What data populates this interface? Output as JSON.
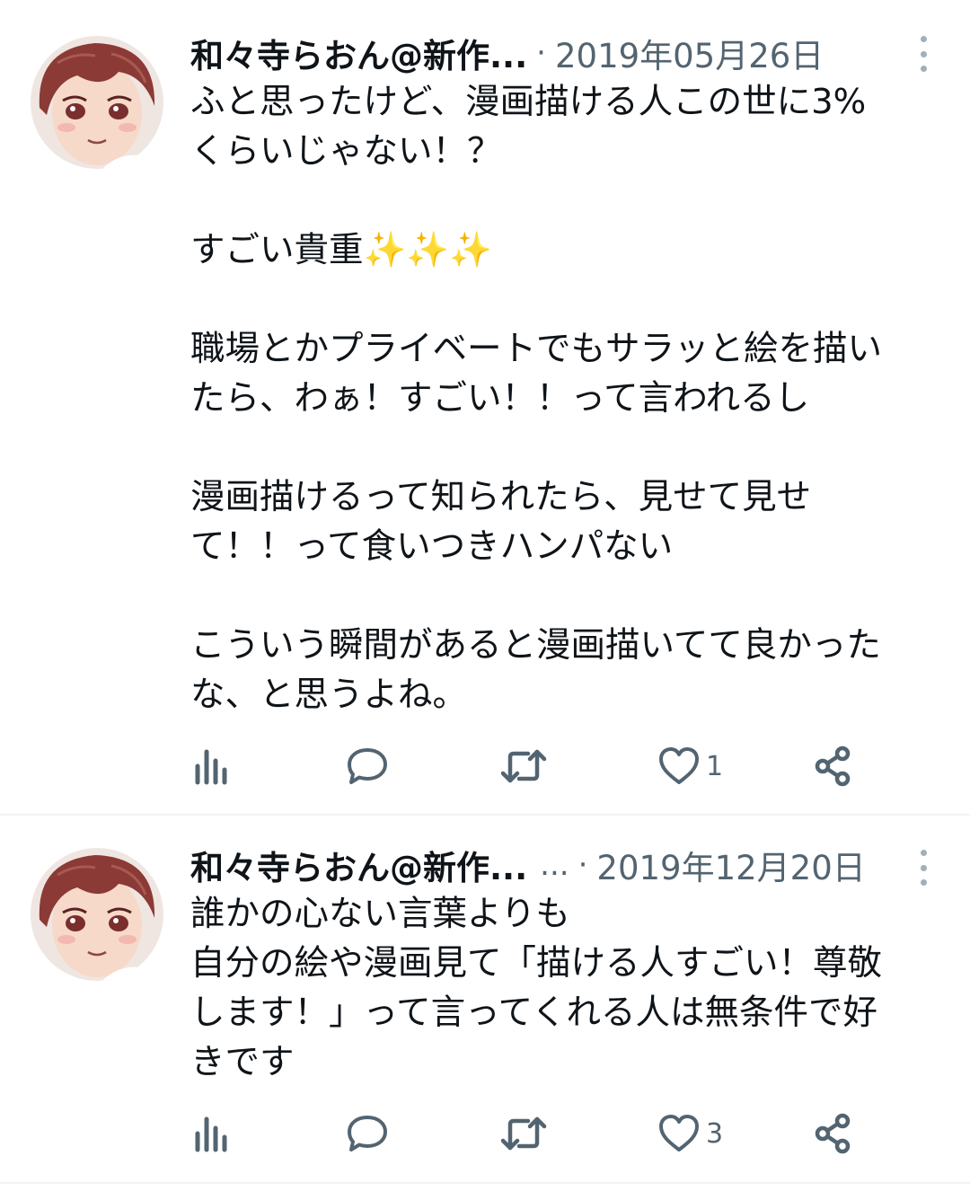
{
  "tweets": [
    {
      "author_name": "和々寺らおん@新作...",
      "separator": "·",
      "date": "2019年05月26日",
      "text": "ふと思ったけど、漫画描ける人この世に3%\nくらいじゃない！？\n\nすごい貴重✨✨✨\n\n職場とかプライベートでもサラッと絵を描い\nたら、わぁ！すごい！！って言われるし\n\n漫画描けるって知られたら、見せて見せ\nて！！って食いつきハンパない\n\nこういう瞬間があると漫画描いてて良かった\nな、と思うよね。",
      "likes": "1",
      "icons": [
        "analytics-icon",
        "reply-icon",
        "retweet-icon",
        "like-icon",
        "share-icon"
      ]
    },
    {
      "author_name": "和々寺らおん@新作...",
      "extra": "...",
      "separator": "·",
      "date": "2019年12月20日",
      "text": "誰かの心ない言葉よりも\n自分の絵や漫画見て「描ける人すごい！尊敬\nします！」って言ってくれる人は無条件で好\nきです",
      "likes": "3",
      "icons": [
        "analytics-icon",
        "reply-icon",
        "retweet-icon",
        "like-icon",
        "share-icon"
      ]
    }
  ],
  "colors": {
    "text": "#0f1419",
    "secondary": "#536471",
    "divider": "#eff3f4",
    "hair": "#8b3a36"
  }
}
